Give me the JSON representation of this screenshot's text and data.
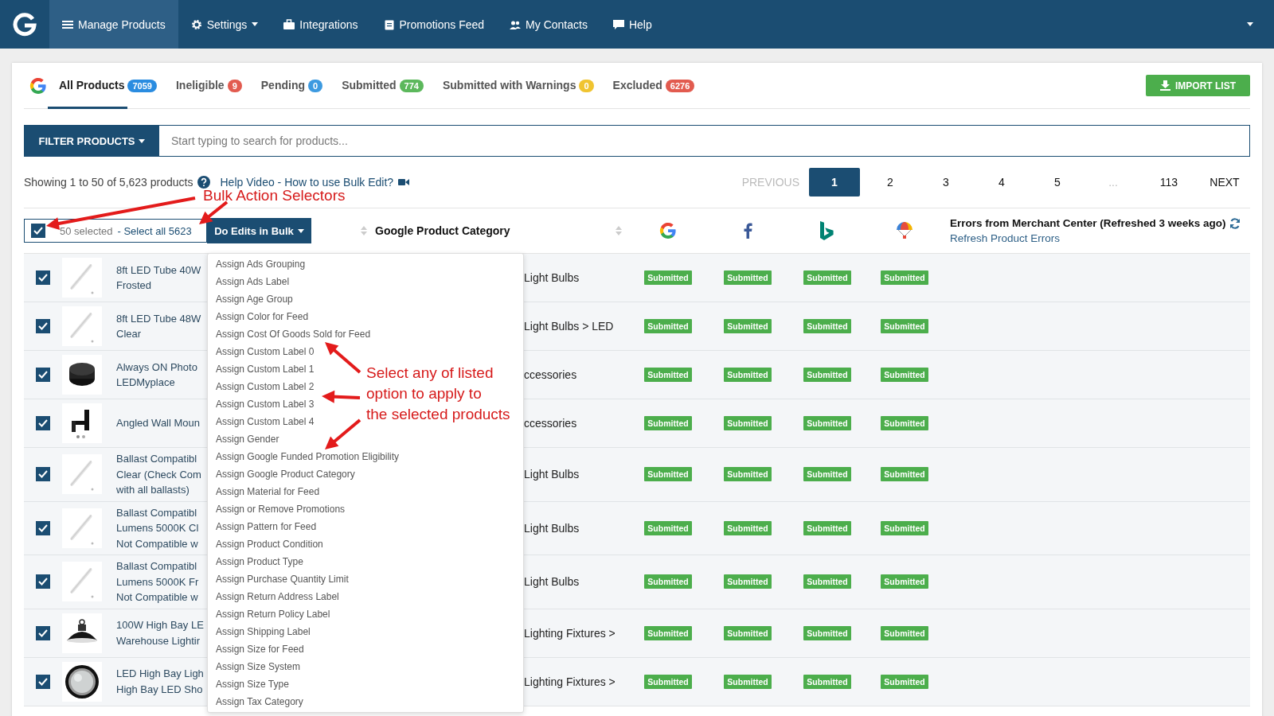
{
  "nav": {
    "items": [
      {
        "label": "Manage Products",
        "selected": true,
        "has_menu": false
      },
      {
        "label": "Settings",
        "selected": false,
        "has_menu": true
      },
      {
        "label": "Integrations",
        "selected": false,
        "has_menu": false
      },
      {
        "label": "Promotions Feed",
        "selected": false,
        "has_menu": false
      },
      {
        "label": "My Contacts",
        "selected": false,
        "has_menu": false
      },
      {
        "label": "Help",
        "selected": false,
        "has_menu": false
      }
    ]
  },
  "tabs": [
    {
      "label": "All Products",
      "count": "7059",
      "color": "#2a8ce0",
      "selected": true
    },
    {
      "label": "Ineligible",
      "count": "9",
      "color": "#e25b4f",
      "selected": false
    },
    {
      "label": "Pending",
      "count": "0",
      "color": "#3d9ae0",
      "selected": false
    },
    {
      "label": "Submitted",
      "count": "774",
      "color": "#5cb85c",
      "selected": false
    },
    {
      "label": "Submitted with Warnings",
      "count": "0",
      "color": "#f0c430",
      "selected": false
    },
    {
      "label": "Excluded",
      "count": "6276",
      "color": "#e25b4f",
      "selected": false
    }
  ],
  "import_button": "IMPORT LIST",
  "filter": {
    "button": "FILTER PRODUCTS",
    "placeholder": "Start typing to search for products..."
  },
  "summary": "Showing 1 to 50 of 5,623 products",
  "help_link": "Help Video - How to use Bulk Edit?",
  "pagination": [
    {
      "label": "PREVIOUS",
      "selected": false,
      "disabled": true
    },
    {
      "label": "1",
      "selected": true,
      "disabled": false
    },
    {
      "label": "2",
      "selected": false,
      "disabled": false
    },
    {
      "label": "3",
      "selected": false,
      "disabled": false
    },
    {
      "label": "4",
      "selected": false,
      "disabled": false
    },
    {
      "label": "5",
      "selected": false,
      "disabled": false
    },
    {
      "label": "...",
      "selected": false,
      "disabled": true
    },
    {
      "label": "113",
      "selected": false,
      "disabled": false
    },
    {
      "label": "NEXT",
      "selected": false,
      "disabled": false
    }
  ],
  "table": {
    "select_all": {
      "checked": true,
      "count_text": "50 selected",
      "link": "- Select all 5623"
    },
    "bulk_button": "Do Edits in Bulk",
    "category_header": "Google Product Category",
    "channels": [
      {
        "kind": "google"
      },
      {
        "kind": "facebook"
      },
      {
        "kind": "bing"
      },
      {
        "kind": "umbrella"
      }
    ],
    "errors_header": "Errors from Merchant Center (Refreshed 3 weeks ago)",
    "errors_link": "Refresh Product Errors",
    "rows": [
      {
        "checked": true,
        "name": [
          "8ft LED Tube 40W",
          "Frosted"
        ],
        "category": "Light Bulbs",
        "statuses": [
          "Submitted",
          "Submitted",
          "Submitted",
          "Submitted"
        ]
      },
      {
        "checked": true,
        "name": [
          "8ft LED Tube 48W",
          "Clear"
        ],
        "category": "Light Bulbs > LED",
        "statuses": [
          "Submitted",
          "Submitted",
          "Submitted",
          "Submitted"
        ]
      },
      {
        "checked": true,
        "name": [
          "Always ON Photo",
          "LEDMyplace"
        ],
        "category": "ccessories",
        "statuses": [
          "Submitted",
          "Submitted",
          "Submitted",
          "Submitted"
        ]
      },
      {
        "checked": true,
        "name": [
          "Angled Wall Moun"
        ],
        "category": "ccessories",
        "statuses": [
          "Submitted",
          "Submitted",
          "Submitted",
          "Submitted"
        ]
      },
      {
        "checked": true,
        "name": [
          "Ballast Compatibl",
          "Clear (Check Com",
          "with all ballasts)"
        ],
        "category": "Light Bulbs",
        "statuses": [
          "Submitted",
          "Submitted",
          "Submitted",
          "Submitted"
        ]
      },
      {
        "checked": true,
        "name": [
          "Ballast Compatibl",
          "Lumens 5000K Cl",
          "Not Compatible w"
        ],
        "category": "Light Bulbs",
        "statuses": [
          "Submitted",
          "Submitted",
          "Submitted",
          "Submitted"
        ]
      },
      {
        "checked": true,
        "name": [
          "Ballast Compatibl",
          "Lumens 5000K Fr",
          "Not Compatible w"
        ],
        "category": "Light Bulbs",
        "statuses": [
          "Submitted",
          "Submitted",
          "Submitted",
          "Submitted"
        ]
      },
      {
        "checked": true,
        "name": [
          "100W High Bay LE",
          "Warehouse Lightir"
        ],
        "category": "Lighting Fixtures >",
        "statuses": [
          "Submitted",
          "Submitted",
          "Submitted",
          "Submitted"
        ]
      },
      {
        "checked": true,
        "name": [
          "LED High Bay Ligh",
          "High Bay LED Sho"
        ],
        "category": "Lighting Fixtures >",
        "statuses": [
          "Submitted",
          "Submitted",
          "Submitted",
          "Submitted"
        ]
      }
    ]
  },
  "bulk_menu": {
    "items": [
      "Assign Ads Grouping",
      "Assign Ads Label",
      "Assign Age Group",
      "Assign Color for Feed",
      "Assign Cost Of Goods Sold for Feed",
      "Assign Custom Label 0",
      "Assign Custom Label 1",
      "Assign Custom Label 2",
      "Assign Custom Label 3",
      "Assign Custom Label 4",
      "Assign Gender",
      "Assign Google Funded Promotion Eligibility",
      "Assign Google Product Category",
      "Assign Material for Feed",
      "Assign or Remove Promotions",
      "Assign Pattern for Feed",
      "Assign Product Condition",
      "Assign Product Type",
      "Assign Purchase Quantity Limit",
      "Assign Return Address Label",
      "Assign Return Policy Label",
      "Assign Shipping Label",
      "Assign Size for Feed",
      "Assign Size System",
      "Assign Size Type",
      "Assign Tax Category"
    ]
  },
  "annotations": [
    {
      "lines": [
        "Bulk Action Selectors"
      ]
    },
    {
      "lines": [
        "Select any of listed",
        "option to apply to",
        "the selected products"
      ]
    }
  ]
}
